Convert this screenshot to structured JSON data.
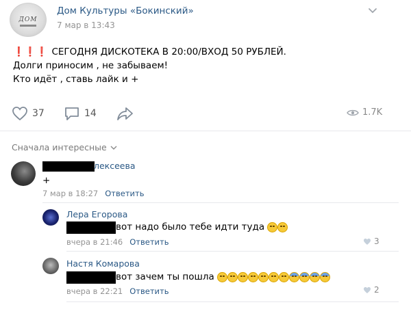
{
  "post": {
    "author": "Дом Культуры «Бокинский»",
    "date": "7 мар в 13:43",
    "avatar_logo": "ДОМ",
    "text_line1": "СЕГОДНЯ ДИСКОТЕКА В 20:00/ВХОД 50 РУБЛЕЙ.",
    "text_line2": "Долги приносим , не забываем!",
    "text_line3": "Кто идёт , ставь лайк и +",
    "exclamations": "❗❗❗",
    "likes": "37",
    "comments": "14",
    "views": "1.7K"
  },
  "sort_label": "Сначала интересные",
  "comments": [
    {
      "name_visible": "лексеева",
      "text": "+",
      "date": "7 мар в 18:27",
      "reply_label": "Ответить"
    }
  ],
  "replies": [
    {
      "name": "Лера Егорова",
      "text": "вот надо было тебе идти туда",
      "date": "вчера в 21:46",
      "reply_label": "Ответить",
      "likes": "3"
    },
    {
      "name": "Настя Комарова",
      "text": "вот зачем ты пошла",
      "date": "вчера в 22:21",
      "reply_label": "Ответить",
      "likes": "2"
    }
  ],
  "icons": [
    "heart-icon",
    "comment-icon",
    "share-icon",
    "eye-icon",
    "chevron-down-icon"
  ],
  "colors": {
    "link": "#2a5885",
    "accent_red": "#e3262b",
    "meta": "#939393"
  }
}
